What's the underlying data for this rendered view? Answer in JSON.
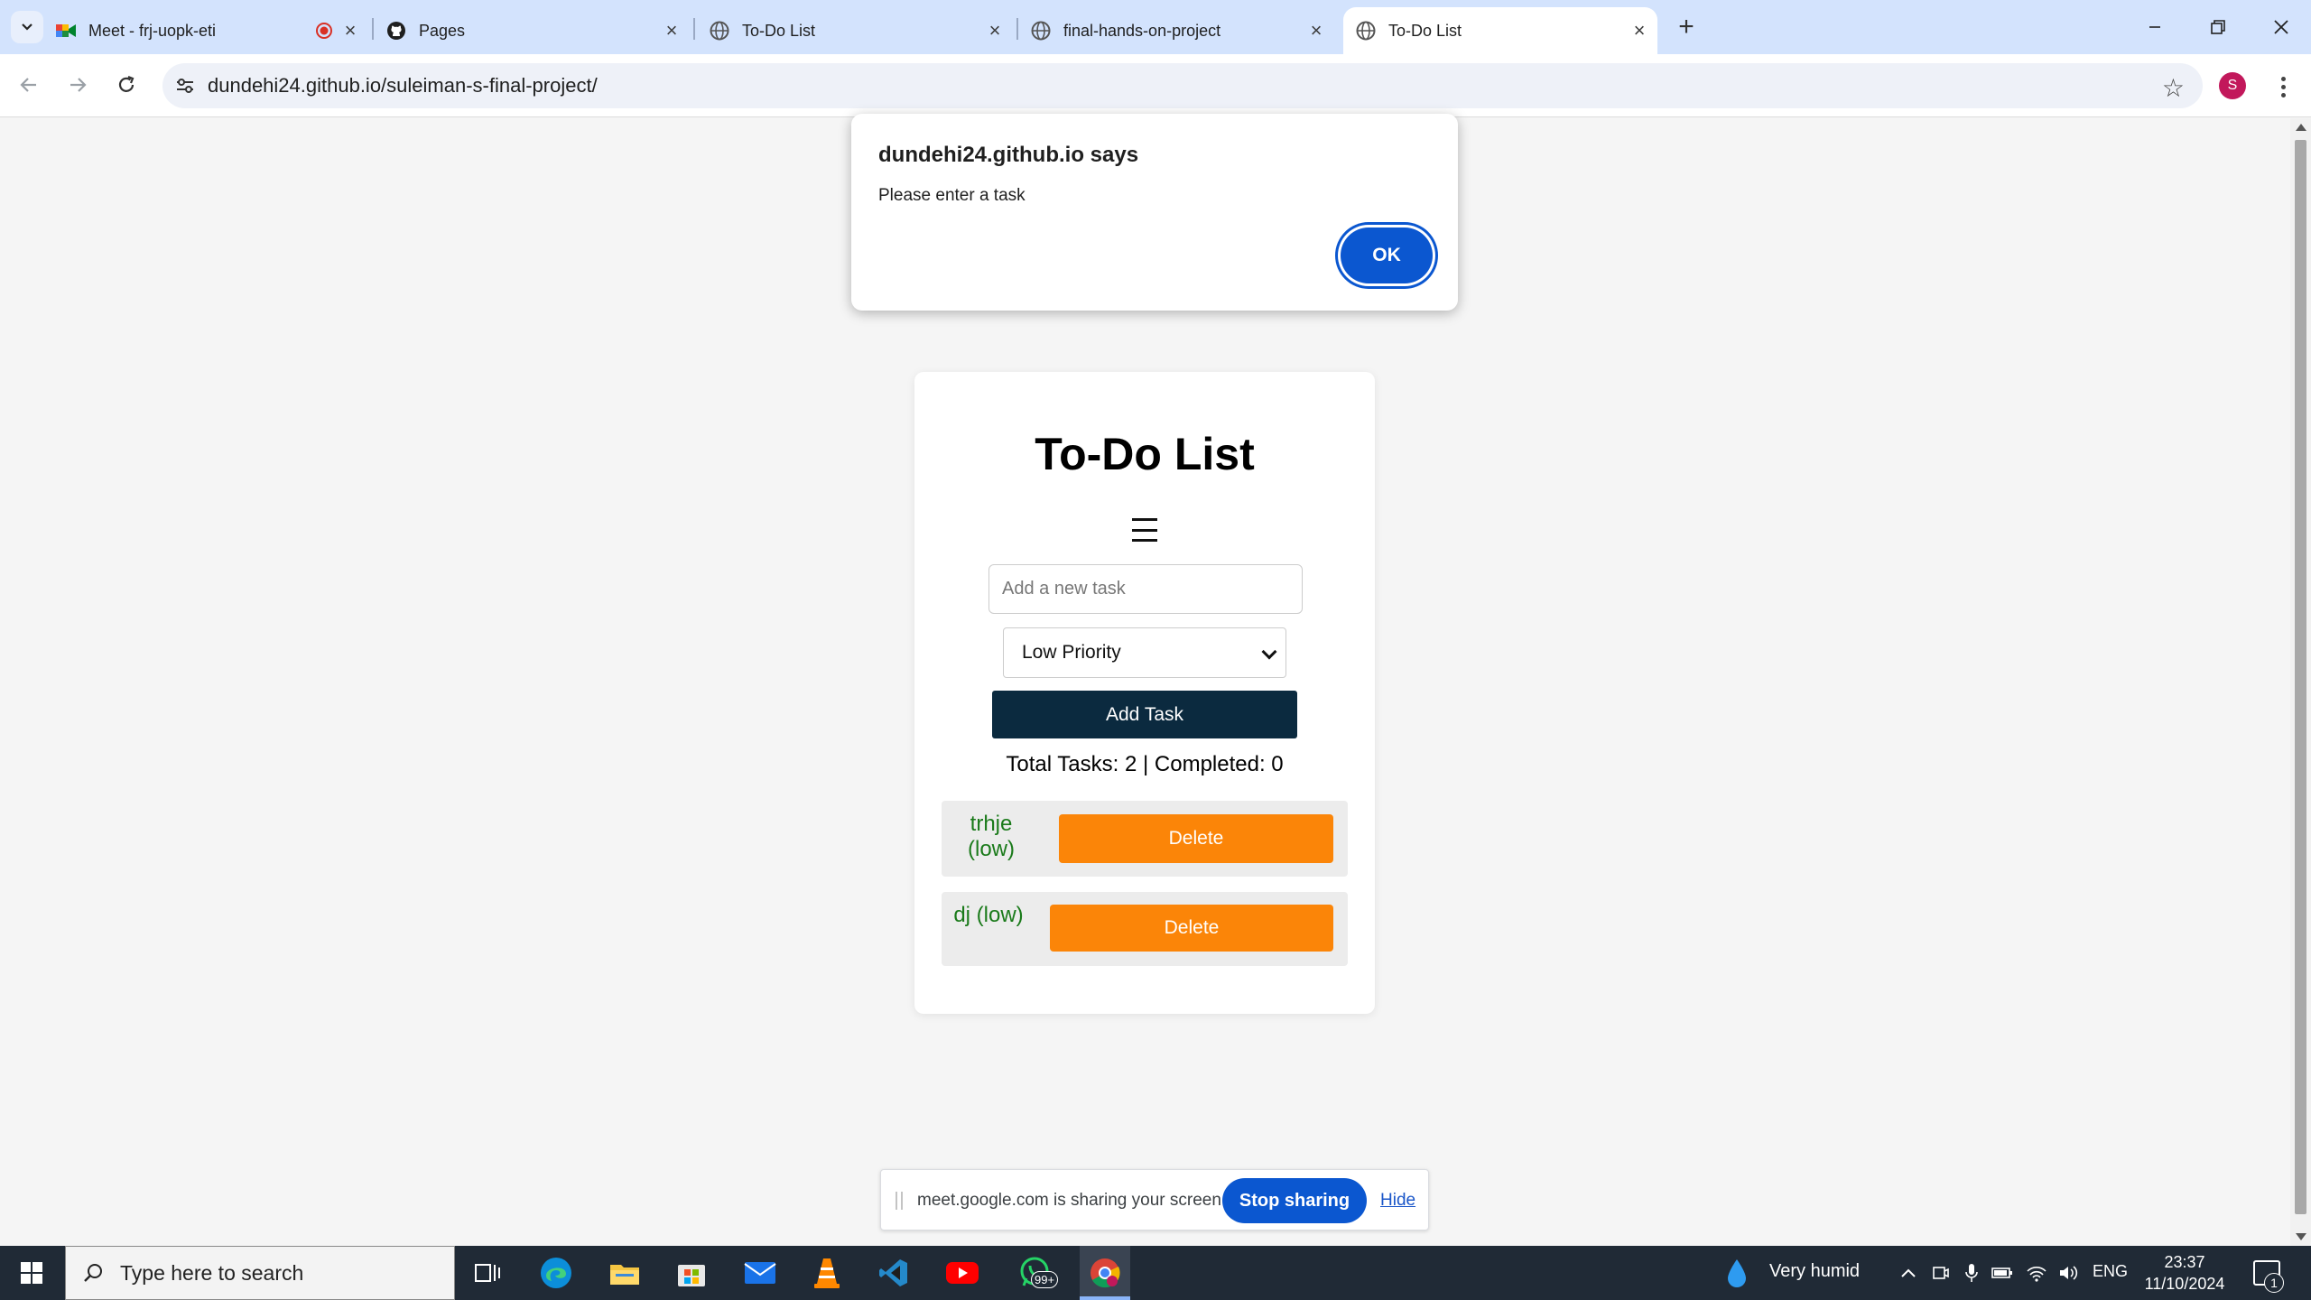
{
  "browser": {
    "tabs": [
      {
        "title": "Meet - frj-uopk-eti",
        "favicon": "google-meet-icon",
        "recording": true
      },
      {
        "title": "Pages",
        "favicon": "github-icon"
      },
      {
        "title": "To-Do List",
        "favicon": "globe-icon"
      },
      {
        "title": "final-hands-on-project",
        "favicon": "globe-icon"
      },
      {
        "title": "To-Do List",
        "favicon": "globe-icon",
        "active": true
      }
    ],
    "url": "dundehi24.github.io/suleiman-s-final-project/",
    "profile_initial": "S"
  },
  "alert": {
    "title": "dundehi24.github.io says",
    "message": "Please enter a task",
    "ok_label": "OK"
  },
  "app": {
    "title": "To-Do List",
    "task_input_placeholder": "Add a new task",
    "task_input_value": "",
    "priority_selected": "Low Priority",
    "add_button_label": "Add Task",
    "stats_text": "Total Tasks: 2 | Completed: 0",
    "tasks": [
      {
        "text": "trhje (low)",
        "line1": "trhje",
        "line2": "(low)",
        "delete_label": "Delete"
      },
      {
        "text": "dj (low)",
        "delete_label": "Delete"
      }
    ],
    "colors": {
      "add_button": "#0b2a3f",
      "delete_button": "#fb8508",
      "task_text": "#1a7a1a"
    }
  },
  "share_bar": {
    "text": "meet.google.com is sharing your screen.",
    "stop_label": "Stop sharing",
    "hide_label": "Hide"
  },
  "taskbar": {
    "search_placeholder": "Type here to search",
    "weather": "Very humid",
    "language": "ENG",
    "time": "23:37",
    "date": "11/10/2024",
    "whatsapp_badge": "99+",
    "notification_count": "1"
  }
}
